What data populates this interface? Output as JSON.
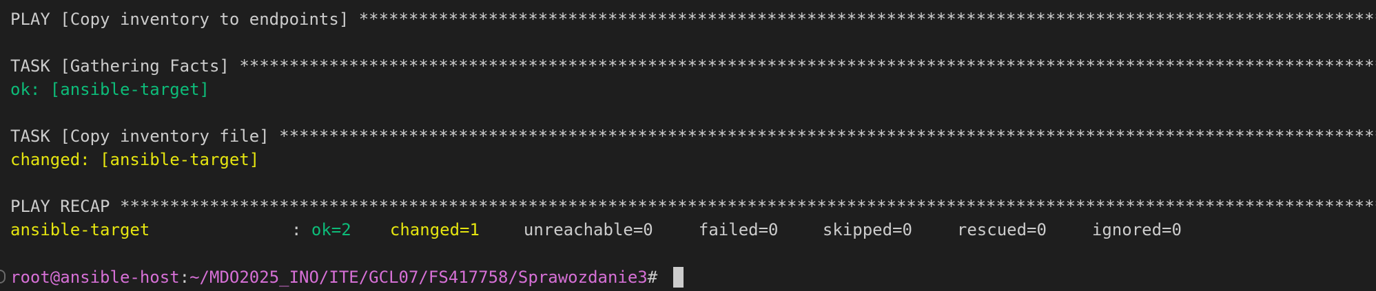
{
  "terminal": {
    "play_line": "PLAY [Copy inventory to endpoints] *******************************************************************************************************************************************************",
    "task1_line": "TASK [Gathering Facts] *******************************************************************************************************************************************************************",
    "task1_result": "ok: [ansible-target]",
    "task2_line": "TASK [Copy inventory file] ***************************************************************************************************************************************************************",
    "task2_result": "changed: [ansible-target]",
    "recap_line": "PLAY RECAP *******************************************************************************************************************************************************************************",
    "recap": {
      "host": "ansible-target",
      "separator": ": ",
      "ok": "ok=2",
      "changed": "changed=1",
      "unreachable": "unreachable=0",
      "failed": "failed=0",
      "skipped": "skipped=0",
      "rescued": "rescued=0",
      "ignored": "ignored=0"
    },
    "prompt": {
      "user_host": "root@ansible-host",
      "colon": ":",
      "path": "~/MDO2025_INO/ITE/GCL07/FS417758/Sprawozdanie3",
      "symbol": "# "
    },
    "colors": {
      "background": "#1e1e1e",
      "foreground": "#cccccc",
      "ok": "#0dbc79",
      "changed": "#e5e510",
      "prompt_user": "#d670d6"
    }
  }
}
